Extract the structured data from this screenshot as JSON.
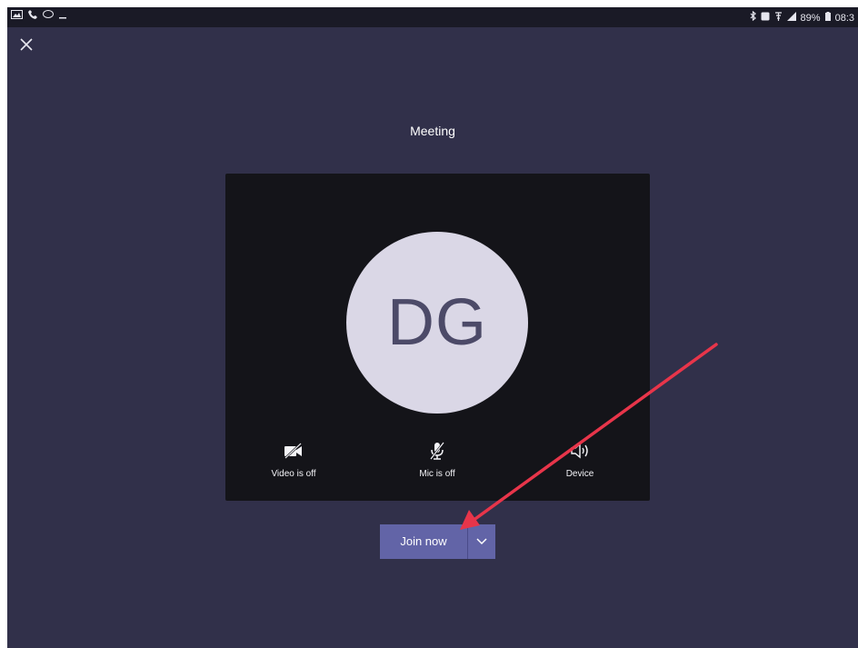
{
  "status_bar": {
    "right_text": "89%",
    "time": "08:3"
  },
  "meeting": {
    "title": "Meeting",
    "avatar_initials": "DG"
  },
  "controls": [
    {
      "label": "Video is off",
      "icon": "video-off-icon"
    },
    {
      "label": "Mic is off",
      "icon": "mic-off-icon"
    },
    {
      "label": "Device",
      "icon": "speaker-icon"
    }
  ],
  "join": {
    "label": "Join now",
    "dropdown_icon": "chevron-down-icon"
  },
  "colors": {
    "background": "#31304a",
    "preview": "#141419",
    "avatar_bg": "#dad7e6",
    "avatar_text": "#4c4a68",
    "join_button": "#6264a7",
    "annotation_arrow": "#e8354a"
  }
}
